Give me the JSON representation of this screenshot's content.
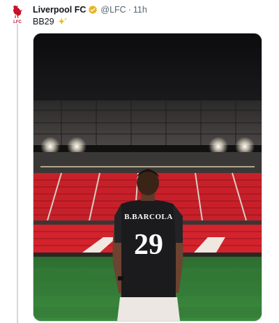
{
  "tweet": {
    "author_name": "Liverpool FC",
    "handle": "@LFC",
    "separator": "·",
    "time": "11h",
    "text": "BB29",
    "emoji_icon": "sparkle-stars-icon"
  },
  "media": {
    "shirt_name": "B.BARCOLA",
    "shirt_number": "29",
    "colors": {
      "stands": "#c8202a",
      "pitch": "#2f7d34",
      "shirt": "#1b1b1d"
    }
  },
  "colors": {
    "verified": "#e8b321",
    "lfc_red": "#c8102e",
    "muted_text": "#536471"
  }
}
